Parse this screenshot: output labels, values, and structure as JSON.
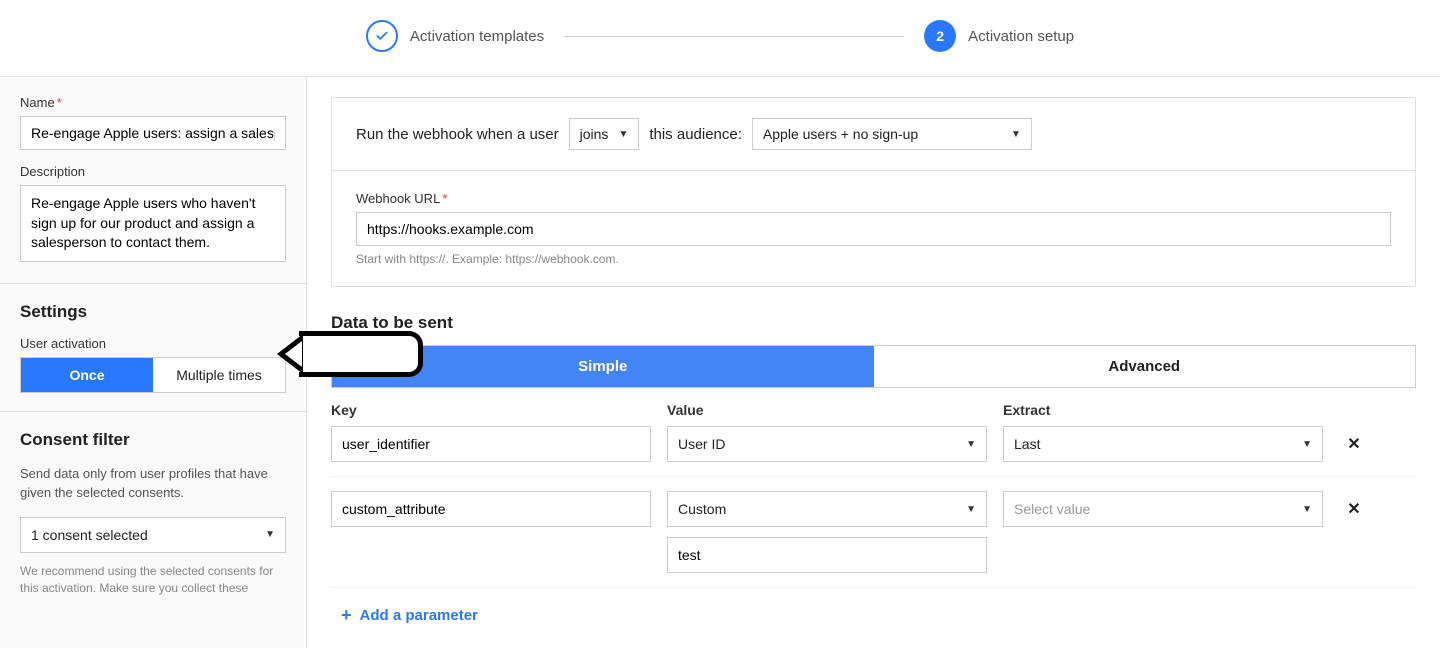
{
  "stepper": {
    "step1_label": "Activation templates",
    "step2_num": "2",
    "step2_label": "Activation setup"
  },
  "sidebar": {
    "name_label": "Name",
    "name_value": "Re-engage Apple users: assign a salesperson",
    "desc_label": "Description",
    "desc_value": "Re-engage Apple users who haven't sign up for our product and assign a salesperson to contact them.",
    "settings_heading": "Settings",
    "user_activation_label": "User activation",
    "toggle_once": "Once",
    "toggle_multiple": "Multiple times",
    "consent_heading": "Consent filter",
    "consent_help": "Send data only from user profiles that have given the selected consents.",
    "consent_selected": "1 consent selected",
    "consent_fineprint": "We recommend using the selected consents for this activation. Make sure you collect these"
  },
  "main": {
    "run_prefix": "Run the webhook when a user",
    "run_action": "joins",
    "run_suffix": "this audience:",
    "audience_selected": "Apple users + no sign-up",
    "webhook_label": "Webhook URL",
    "webhook_value": "https://hooks.example.com",
    "webhook_hint": "Start with https://. Example: https://webhook.com.",
    "data_heading": "Data to be sent",
    "tab_simple": "Simple",
    "tab_advanced": "Advanced",
    "col_key": "Key",
    "col_value": "Value",
    "col_extract": "Extract",
    "rows": [
      {
        "key": "user_identifier",
        "value": "User ID",
        "extract": "Last"
      },
      {
        "key": "custom_attribute",
        "value": "Custom",
        "extract_placeholder": "Select value",
        "custom_text": "test"
      }
    ],
    "add_param": "Add a parameter"
  }
}
